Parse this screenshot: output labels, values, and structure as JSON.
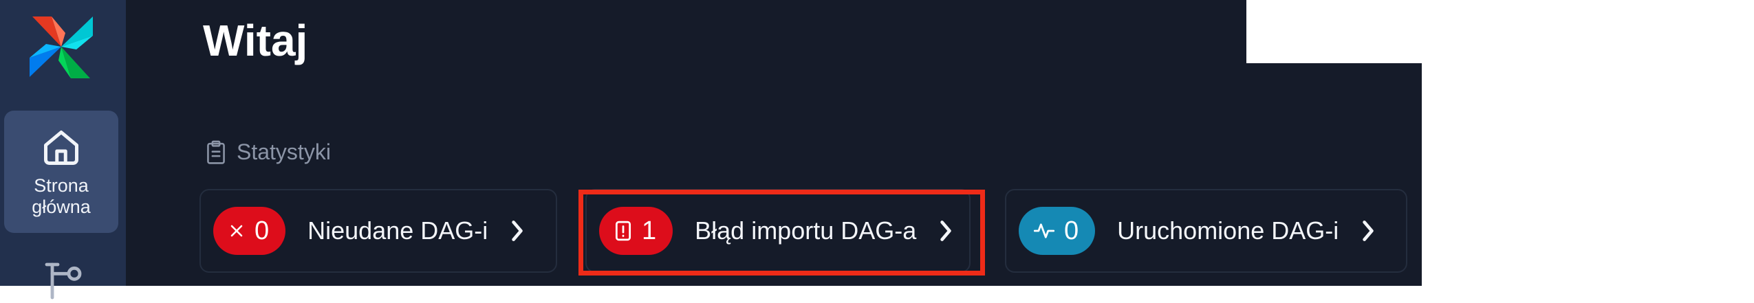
{
  "colors": {
    "background": "#151b29",
    "sidebar": "#22304d",
    "sidebar_active": "#3a4c71",
    "failed_badge": "#dd0d1b",
    "import_badge": "#dd0d1b",
    "running_badge": "#1589b4",
    "highlight": "#ee2b18"
  },
  "sidebar": {
    "logo_icon": "airflow-pinwheel-icon",
    "items": [
      {
        "label": "Strona\ngłówna",
        "icon": "home-icon",
        "active": true
      },
      {
        "label": "",
        "icon": "dags-icon",
        "active": false
      }
    ]
  },
  "main": {
    "title": "Witaj",
    "stats": {
      "header": "Statystyki",
      "header_icon": "clipboard-icon",
      "cards": [
        {
          "count": "0",
          "label": "Nieudane DAG-i",
          "icon": "x-icon"
        },
        {
          "count": "1",
          "label": "Błąd importu DAG-a",
          "icon": "alert-file-icon"
        },
        {
          "count": "0",
          "label": "Uruchomione DAG-i",
          "icon": "activity-icon"
        }
      ]
    }
  }
}
